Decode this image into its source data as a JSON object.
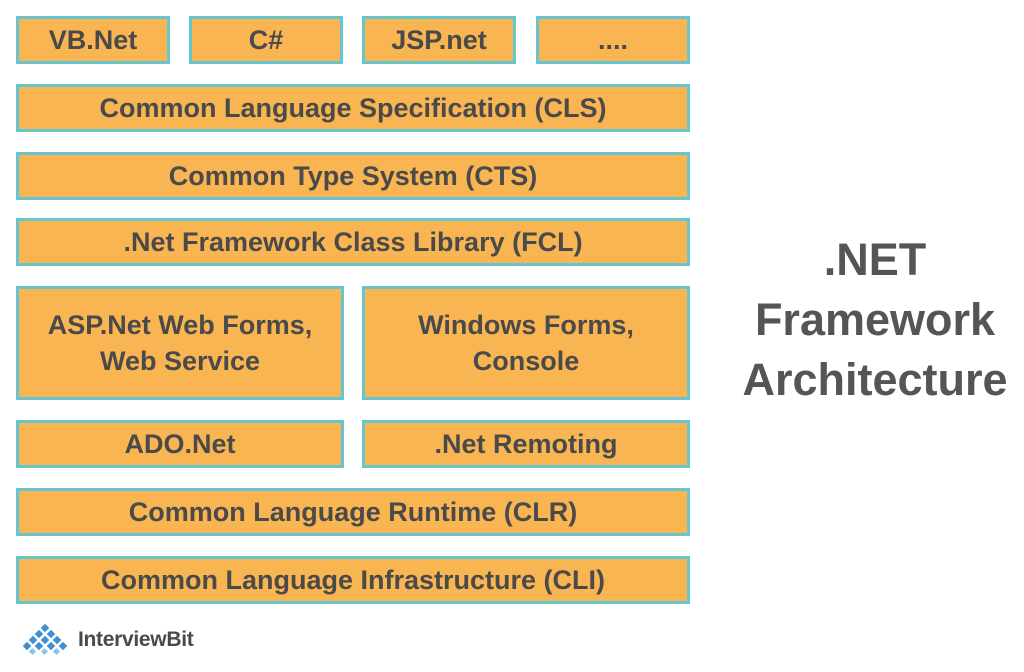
{
  "diagram": {
    "rows": {
      "languages": [
        "VB.Net",
        "C#",
        "JSP.net",
        "...."
      ],
      "cls": "Common Language Specification (CLS)",
      "cts": "Common Type System (CTS)",
      "fcl": ".Net Framework Class Library (FCL)",
      "apps": {
        "asp": [
          "ASP.Net Web Forms,",
          "Web Service"
        ],
        "win": [
          "Windows Forms,",
          "Console"
        ]
      },
      "ado": "ADO.Net",
      "remoting": ".Net Remoting",
      "clr": "Common Language Runtime (CLR)",
      "cli": "Common Language Infrastructure (CLI)"
    },
    "title": [
      ".NET",
      "Framework",
      "Architecture"
    ]
  },
  "brand": {
    "name": "InterviewBit"
  },
  "colors": {
    "box_fill": "#f9b552",
    "box_border": "#66c6cf",
    "text": "#4a4a4a",
    "title_text": "#555555",
    "logo_blue": "#3f8fd2"
  }
}
